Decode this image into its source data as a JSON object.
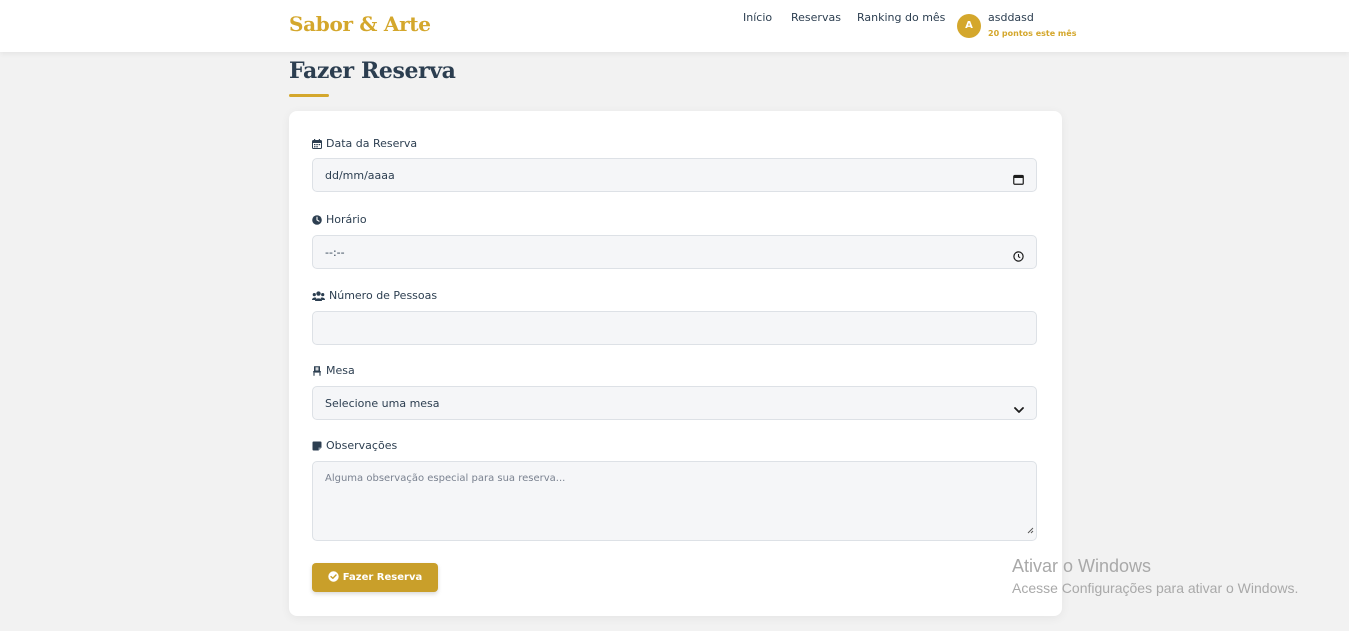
{
  "header": {
    "brand": "Sabor & Arte",
    "nav": [
      "Início",
      "Reservas",
      "Ranking do mês"
    ],
    "user": {
      "initial": "A",
      "name": "asddasd",
      "points": "20 pontos este mês"
    }
  },
  "page": {
    "title": "Fazer Reserva"
  },
  "form": {
    "date": {
      "label": "Data da Reserva",
      "value": "dd/mm/aaaa",
      "icon": "calendar-icon"
    },
    "time": {
      "label": "Horário",
      "value": "--:--",
      "icon": "clock-icon"
    },
    "people": {
      "label": "Número de Pessoas",
      "value": "",
      "icon": "users-icon"
    },
    "table": {
      "label": "Mesa",
      "value": "Selecione uma mesa",
      "icon": "chair-icon"
    },
    "notes": {
      "label": "Observações",
      "placeholder": "Alguma observação especial para sua reserva...",
      "icon": "note-icon"
    },
    "submit_label": "Fazer Reserva"
  },
  "watermark": {
    "title": "Ativar o Windows",
    "subtitle": "Acesse Configurações para ativar o Windows."
  },
  "colors": {
    "accent": "#d4a72c",
    "button": "#c99f2a",
    "text": "#2c3e50",
    "background": "#f2f2f2"
  }
}
